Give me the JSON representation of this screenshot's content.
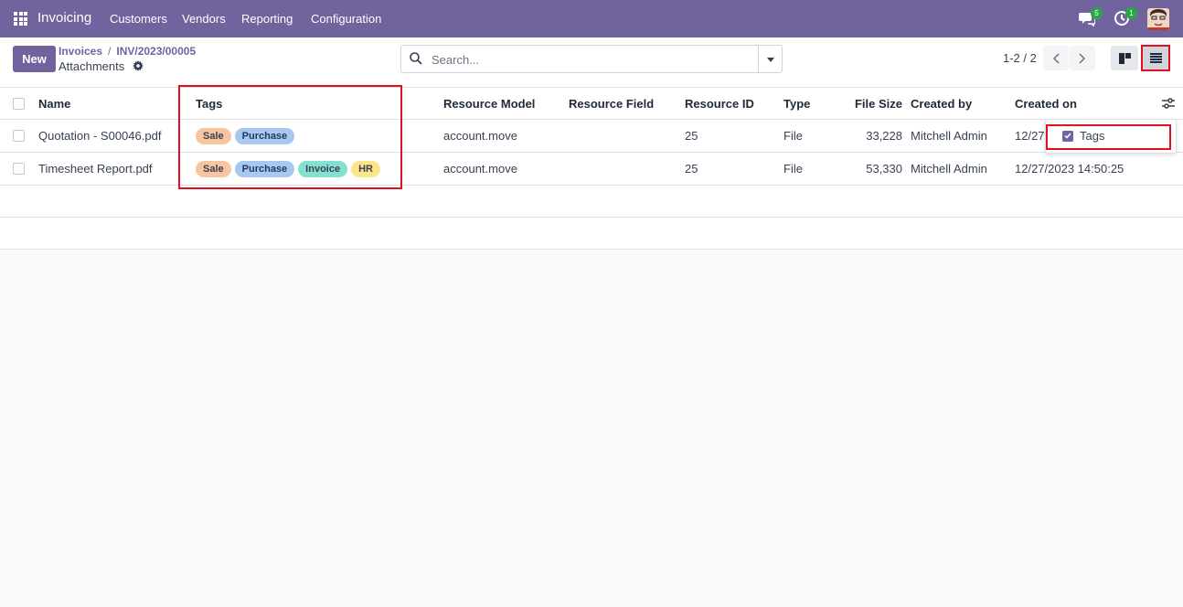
{
  "navbar": {
    "brand": "Invoicing",
    "menu": [
      "Customers",
      "Vendors",
      "Reporting",
      "Configuration"
    ],
    "chat_count": "5",
    "activity_count": "1"
  },
  "control_panel": {
    "new_label": "New",
    "breadcrumb": [
      "Invoices",
      "INV/2023/00005"
    ],
    "title": "Attachments",
    "search_placeholder": "Search...",
    "pager": "1-2 / 2"
  },
  "table": {
    "columns": [
      "Name",
      "Tags",
      "Resource Model",
      "Resource Field",
      "Resource ID",
      "Type",
      "File Size",
      "Created by",
      "Created on"
    ],
    "rows": [
      {
        "name": "Quotation - S00046.pdf",
        "tags": [
          "Sale",
          "Purchase"
        ],
        "resource_model": "account.move",
        "resource_field": "",
        "resource_id": "25",
        "type": "File",
        "file_size": "33,228",
        "created_by": "Mitchell Admin",
        "created_on": "12/27"
      },
      {
        "name": "Timesheet Report.pdf",
        "tags": [
          "Sale",
          "Purchase",
          "Invoice",
          "HR"
        ],
        "resource_model": "account.move",
        "resource_field": "",
        "resource_id": "25",
        "type": "File",
        "file_size": "53,330",
        "created_by": "Mitchell Admin",
        "created_on": "12/27/2023 14:50:25"
      }
    ]
  },
  "optional_columns": {
    "items": [
      {
        "label": "Tags",
        "checked": true
      }
    ]
  },
  "colors": {
    "brand": "#71639e",
    "highlight": "#e0111c",
    "tag_sale": "#f7c59f",
    "tag_purchase": "#a8c8f0",
    "tag_invoice": "#86e0d1",
    "tag_hr": "#fde38a"
  }
}
